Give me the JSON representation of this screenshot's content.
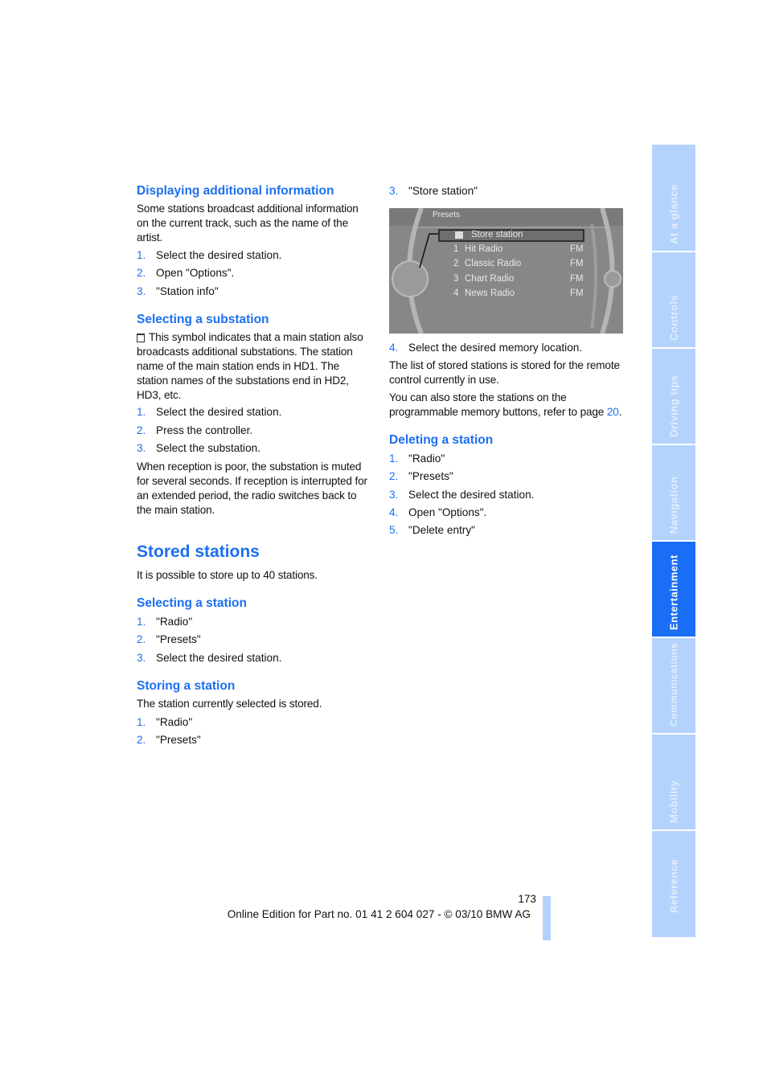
{
  "left": {
    "h_display": "Displaying additional information",
    "p_display": "Some stations broadcast additional information on the current track, such as the name of the artist.",
    "list_display": [
      {
        "n": "1.",
        "t": "Select the desired station."
      },
      {
        "n": "2.",
        "t": "Open \"Options\"."
      },
      {
        "n": "3.",
        "t": "\"Station info\""
      }
    ],
    "h_sub": "Selecting a substation",
    "p_sub": "This symbol indicates that a main station also broadcasts additional substations. The station name of the main station ends in HD1. The station names of the substations end in HD2, HD3, etc.",
    "list_sub": [
      {
        "n": "1.",
        "t": "Select the desired station."
      },
      {
        "n": "2.",
        "t": "Press the controller."
      },
      {
        "n": "3.",
        "t": "Select the substation."
      }
    ],
    "p_reception": "When reception is poor, the substation is muted for several seconds. If reception is interrupted for an extended period, the radio switches back to the main station.",
    "h_stored": "Stored stations",
    "p_stored": "It is possible to store up to 40 stations.",
    "h_select": "Selecting a station",
    "list_select": [
      {
        "n": "1.",
        "t": "\"Radio\""
      },
      {
        "n": "2.",
        "t": "\"Presets\""
      },
      {
        "n": "3.",
        "t": "Select the desired station."
      }
    ],
    "h_store": "Storing a station",
    "p_store": "The station currently selected is stored.",
    "list_store": [
      {
        "n": "1.",
        "t": "\"Radio\""
      },
      {
        "n": "2.",
        "t": "\"Presets\""
      }
    ]
  },
  "right": {
    "step3": {
      "n": "3.",
      "t": "\"Store station\""
    },
    "screen": {
      "title": "Presets",
      "store": "Store station",
      "rows": [
        {
          "n": "1",
          "name": "Hit Radio",
          "band": "FM"
        },
        {
          "n": "2",
          "name": "Classic Radio",
          "band": "FM"
        },
        {
          "n": "3",
          "name": "Chart Radio",
          "band": "FM"
        },
        {
          "n": "4",
          "name": "News Radio",
          "band": "FM"
        }
      ]
    },
    "step4": {
      "n": "4.",
      "t": "Select the desired memory location."
    },
    "p_list": "The list of stored stations is stored for the remote control currently in use.",
    "p_also": "You can also store the stations on the programmable memory buttons, refer to page ",
    "p_also_link": "20",
    "p_also_end": ".",
    "h_delete": "Deleting a station",
    "list_delete": [
      {
        "n": "1.",
        "t": "\"Radio\""
      },
      {
        "n": "2.",
        "t": "\"Presets\""
      },
      {
        "n": "3.",
        "t": "Select the desired station."
      },
      {
        "n": "4.",
        "t": "Open \"Options\"."
      },
      {
        "n": "5.",
        "t": "\"Delete entry\""
      }
    ]
  },
  "footer": {
    "page": "173",
    "edition": "Online Edition for Part no. 01 41 2 604 027 - © 03/10 BMW AG"
  },
  "tabs": [
    {
      "label": "At a glance",
      "active": false
    },
    {
      "label": "Controls",
      "active": false
    },
    {
      "label": "Driving tips",
      "active": false
    },
    {
      "label": "Navigation",
      "active": false
    },
    {
      "label": "Entertainment",
      "active": true
    },
    {
      "label": "Communications",
      "active": false
    },
    {
      "label": "Mobility",
      "active": false
    },
    {
      "label": "Reference",
      "active": false
    }
  ],
  "colors": {
    "accent": "#1c6ff0",
    "tab": "#b3d3fd",
    "tab_active": "#1a6ef5"
  }
}
